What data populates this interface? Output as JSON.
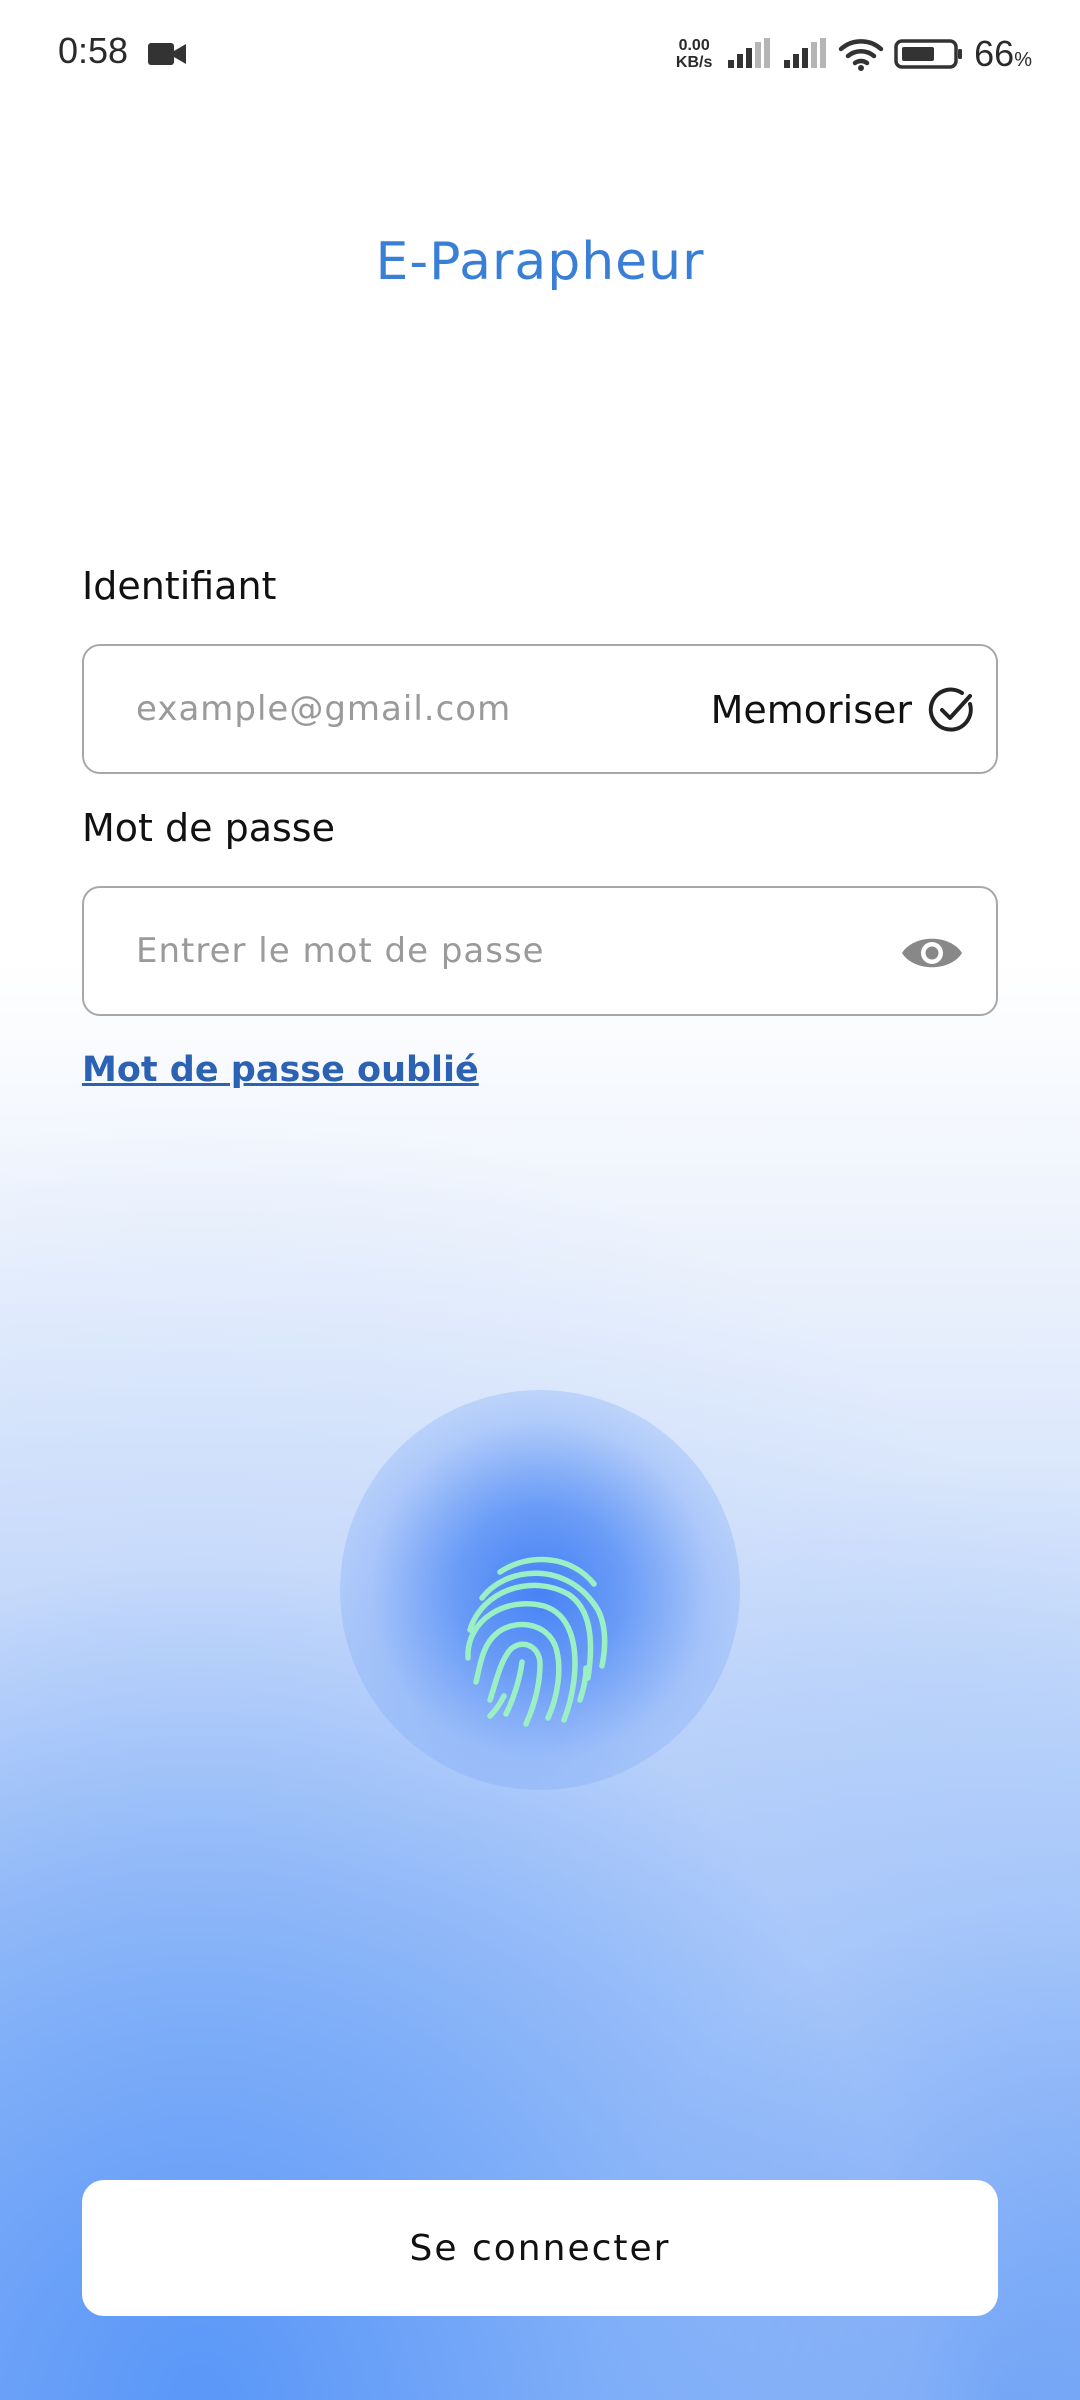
{
  "status_bar": {
    "time": "0:58",
    "net_speed_value": "0.00",
    "net_speed_unit": "KB/s",
    "battery_percent": "66",
    "battery_unit": "%",
    "icons": [
      "video-camera-icon",
      "signal-icon",
      "signal-icon",
      "wifi-icon",
      "battery-icon"
    ]
  },
  "app": {
    "title": "E-Parapheur",
    "accent_color": "#3a7fd6",
    "link_color": "#2b62b3"
  },
  "login": {
    "identifier_label": "Identifiant",
    "identifier_placeholder": "example@gmail.com",
    "identifier_value": "",
    "remember_label": "Memoriser",
    "remember_icon": "check-circle-icon",
    "password_label": "Mot de passe",
    "password_placeholder": "Entrer le mot de passe",
    "password_value": "",
    "password_toggle_icon": "eye-icon",
    "forgot_password": "Mot de passe oublié",
    "biometric_icon": "fingerprint-icon",
    "submit_label": "Se connecter"
  }
}
